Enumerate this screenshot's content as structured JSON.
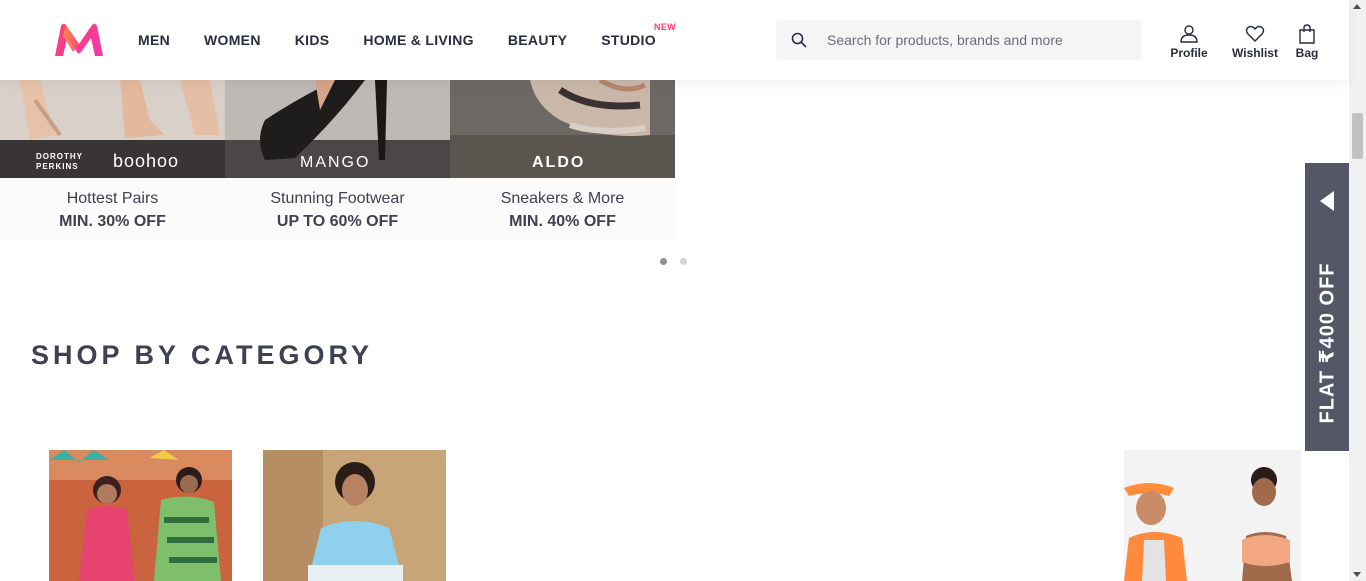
{
  "nav": {
    "items": [
      "MEN",
      "WOMEN",
      "KIDS",
      "HOME & LIVING",
      "BEAUTY",
      "STUDIO"
    ],
    "studio_badge": "NEW"
  },
  "search": {
    "placeholder": "Search for products, brands and more"
  },
  "actions": {
    "profile": "Profile",
    "wishlist": "Wishlist",
    "bag": "Bag"
  },
  "carousel": [
    {
      "brands": [
        "DOROTHY PERKINS",
        "boohoo"
      ],
      "title": "Hottest Pairs",
      "offer": "MIN. 30% OFF"
    },
    {
      "brands": [
        "MANGO"
      ],
      "title": "Stunning Footwear",
      "offer": "UP TO 60% OFF"
    },
    {
      "brands": [
        "ALDO"
      ],
      "title": "Sneakers & More",
      "offer": "MIN. 40% OFF"
    }
  ],
  "carousel_dots": {
    "count": 2,
    "active": 0
  },
  "section": {
    "title": "SHOP BY CATEGORY"
  },
  "side_tab": {
    "label": "FLAT ₹400 OFF"
  },
  "colors": {
    "accent": "#ff3f6c",
    "text": "#282c3f",
    "side_tab": "#535766"
  }
}
